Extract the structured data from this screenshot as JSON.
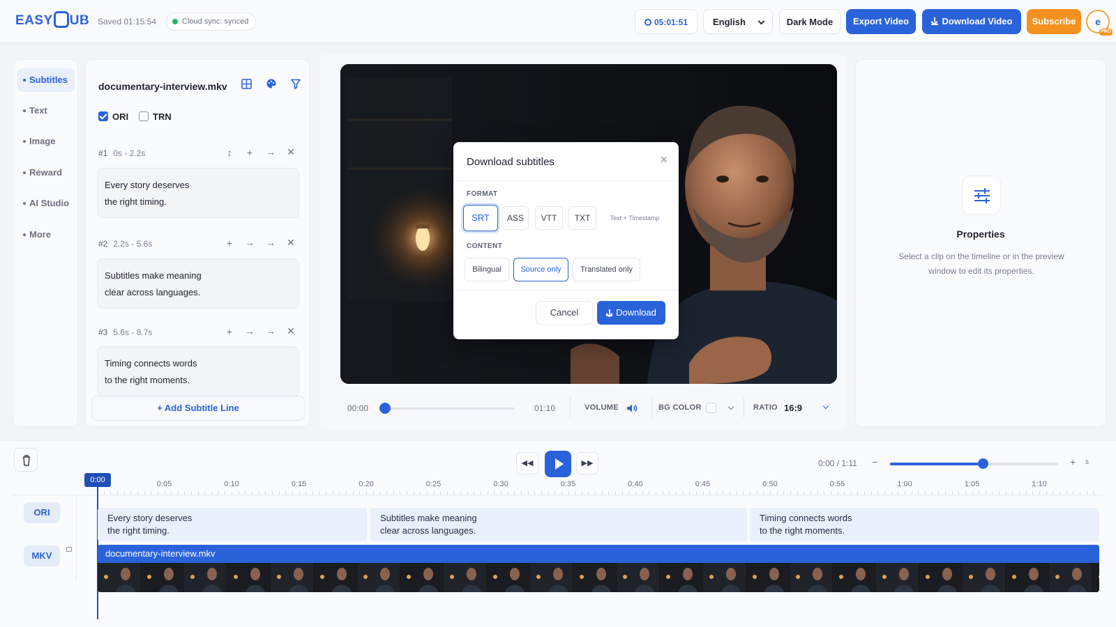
{
  "header": {
    "logo": "EASYSUB",
    "saved": "Saved 01:15:54",
    "sync": "Cloud sync: synced",
    "timer": "05:01:51",
    "language": "English",
    "dark_mode": "Dark Mode",
    "export": "Export Video",
    "download": "Download Video",
    "subscribe": "Subscribe",
    "avatar_letter": "e",
    "pro": "PRO"
  },
  "nav": [
    "Subtitles",
    "Text",
    "Image",
    "Reward",
    "AI Studio",
    "More"
  ],
  "subtitles": {
    "filename": "documentary-interview.mkv",
    "ori_label": "ORI",
    "ori_checked": true,
    "trn_label": "TRN",
    "trn_checked": false,
    "entries": [
      {
        "index": "#1",
        "range": "0s - 2.2s",
        "line1": "Every story deserves",
        "line2": "the right timing."
      },
      {
        "index": "#2",
        "range": "2.2s - 5.6s",
        "line1": "Subtitles make meaning",
        "line2": "clear across languages."
      },
      {
        "index": "#3",
        "range": "5.6s - 8.7s",
        "line1": "Timing connects words",
        "line2": "to the right moments."
      }
    ],
    "add_line": "+ Add Subtitle Line"
  },
  "player": {
    "current": "00:00",
    "duration": "01:10",
    "progress": 0.0,
    "volume_label": "VOLUME",
    "bg_label": "BG COLOR",
    "bg_color": "#ffffff",
    "ratio_label": "RATIO",
    "ratio": "16:9"
  },
  "modal": {
    "title": "Download subtitles",
    "format_label": "FORMAT",
    "formats": [
      "SRT",
      "ASS",
      "VTT",
      "TXT",
      "Text + Timestamp"
    ],
    "selected_format": "SRT",
    "content_label": "CONTENT",
    "contents": [
      "Bilingual",
      "Source only",
      "Translated only"
    ],
    "selected_content": "Source only",
    "cancel": "Cancel",
    "download": "Download"
  },
  "properties": {
    "title": "Properties",
    "desc": "Select a clip on the timeline or in the preview window to edit its properties."
  },
  "timeline": {
    "position": "0:00 / 1:11",
    "playhead": "0:00",
    "zoom_fraction": 0.55,
    "zoom_unit": "s",
    "ticks": [
      "0:05",
      "0:10",
      "0:15",
      "0:20",
      "0:25",
      "0:30",
      "0:35",
      "0:40",
      "0:45",
      "0:50",
      "0:55",
      "1:00",
      "1:05",
      "1:10"
    ],
    "tracks": [
      "ORI",
      "MKV"
    ],
    "clips": [
      {
        "line1": "Every story deserves",
        "line2": "the right timing."
      },
      {
        "line1": "Subtitles make meaning",
        "line2": "clear across languages."
      },
      {
        "line1": "Timing connects words",
        "line2": "to the right moments."
      }
    ],
    "video_clip": "documentary-interview.mkv"
  },
  "colors": {
    "accent": "#2a63d9",
    "subscribe": "#f5911e",
    "synced": "#23b26b"
  }
}
